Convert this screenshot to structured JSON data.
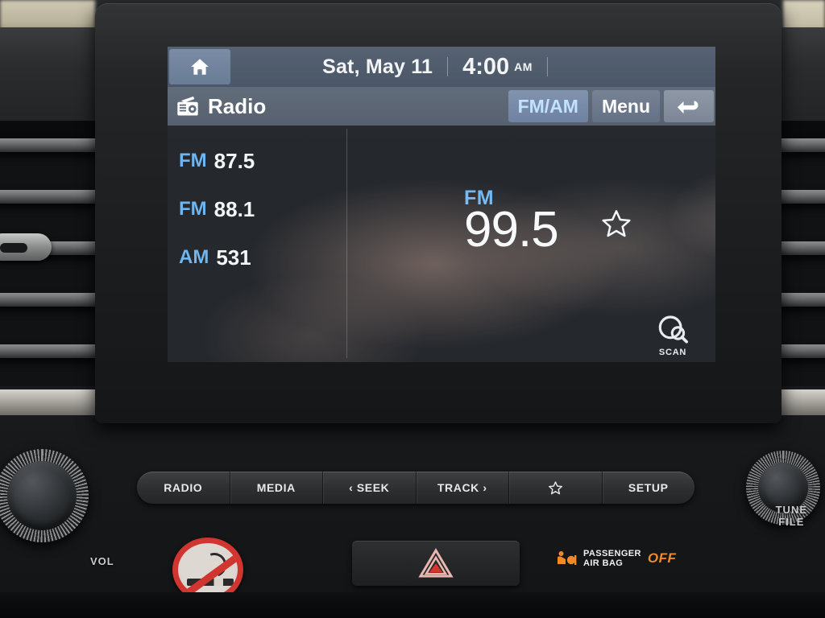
{
  "screen": {
    "statusbar": {
      "home_icon": "home-icon",
      "date": "Sat, May 11",
      "time": "4:00",
      "ampm": "AM"
    },
    "titlebar": {
      "source_icon": "radio-icon",
      "title": "Radio",
      "buttons": [
        {
          "label": "FM/AM",
          "name": "fm-am-button",
          "active": true
        },
        {
          "label": "Menu",
          "name": "menu-button",
          "active": false
        }
      ],
      "back_icon": "back-arrow-icon"
    },
    "presets": [
      {
        "band": "FM",
        "freq": "87.5"
      },
      {
        "band": "FM",
        "freq": "88.1"
      },
      {
        "band": "AM",
        "freq": "531"
      }
    ],
    "tuner": {
      "band": "FM",
      "frequency": "99.5",
      "favorite_icon": "star-outline-icon",
      "scan_icon": "scan-icon",
      "scan_label": "SCAN"
    },
    "colors": {
      "accent_blue": "#6fb6f0",
      "statusbar_bg": "#4d5a6b",
      "titlebar_bg": "#5d6877",
      "screen_bg": "#25282d",
      "text_white": "#f2f4f6"
    }
  },
  "hardware": {
    "buttons": [
      {
        "label": "RADIO",
        "name": "radio-hard-button",
        "icon": null
      },
      {
        "label": "MEDIA",
        "name": "media-hard-button",
        "icon": null
      },
      {
        "label": "‹ SEEK",
        "name": "seek-hard-button",
        "icon": null
      },
      {
        "label": "TRACK ›",
        "name": "track-hard-button",
        "icon": null
      },
      {
        "label": "",
        "name": "favorite-hard-button",
        "icon": "star-outline-icon"
      },
      {
        "label": "SETUP",
        "name": "setup-hard-button",
        "icon": null
      }
    ],
    "knob_left_label": "VOL",
    "knob_right_label_line1": "TUNE",
    "knob_right_label_line2": "FILE"
  },
  "dash": {
    "no_smoking_sticker": "no-smoking-icon",
    "hazard_button": "hazard-triangle-icon",
    "airbag": {
      "icon": "passenger-airbag-icon",
      "line1": "PASSENGER",
      "line2": "AIR BAG",
      "status": "OFF",
      "status_color": "#f08a24"
    }
  }
}
